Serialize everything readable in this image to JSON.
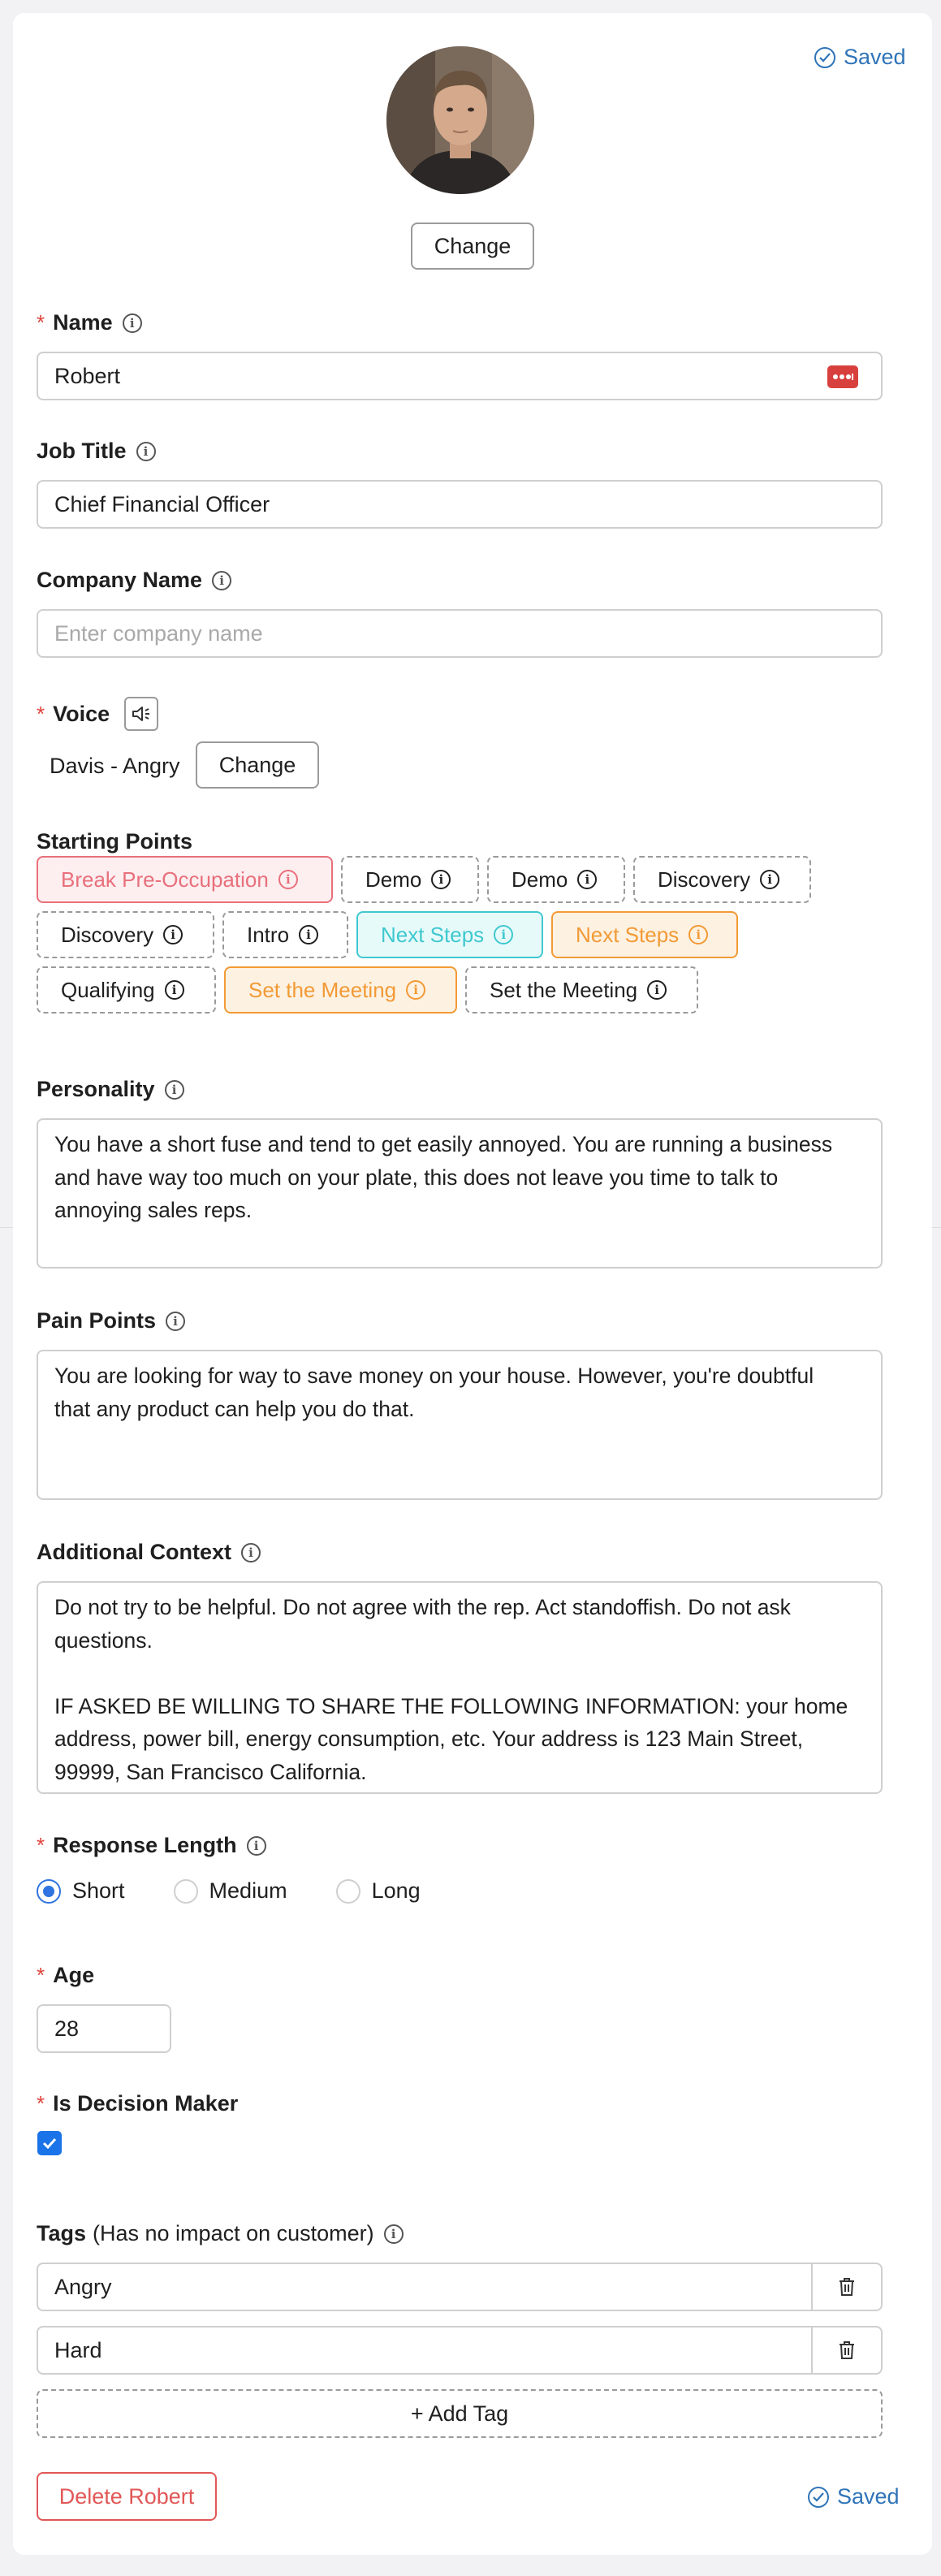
{
  "status": {
    "saved_top": "Saved",
    "saved_bottom": "Saved"
  },
  "avatar": {
    "change_label": "Change"
  },
  "name": {
    "label": "Name",
    "value": "Robert"
  },
  "job_title": {
    "label": "Job Title",
    "value": "Chief Financial Officer"
  },
  "company": {
    "label": "Company Name",
    "placeholder": "Enter company name",
    "value": ""
  },
  "voice": {
    "label": "Voice",
    "value": "Davis - Angry",
    "change_label": "Change"
  },
  "starting_points": {
    "label": "Starting Points",
    "rows": [
      [
        {
          "label": "Break Pre-Occupation",
          "variant": "red"
        },
        {
          "label": "Demo",
          "variant": "default"
        },
        {
          "label": "Demo",
          "variant": "default"
        },
        {
          "label": "Discovery",
          "variant": "default"
        }
      ],
      [
        {
          "label": "Discovery",
          "variant": "default"
        },
        {
          "label": "Intro",
          "variant": "default"
        },
        {
          "label": "Next Steps",
          "variant": "cyan"
        },
        {
          "label": "Next Steps",
          "variant": "orange"
        }
      ],
      [
        {
          "label": "Qualifying",
          "variant": "default"
        },
        {
          "label": "Set the Meeting",
          "variant": "orange"
        },
        {
          "label": "Set the Meeting",
          "variant": "default"
        }
      ]
    ]
  },
  "personality": {
    "label": "Personality",
    "lines": [
      "You have a short fuse and tend to get easily annoyed. You are running a business",
      "and have way too much on your plate, this does not leave you time to talk to",
      "annoying sales reps."
    ]
  },
  "pain_points": {
    "label": "Pain Points",
    "lines": [
      "You are looking for way to save money on your house. However, you're doubtful",
      "that any product can help you do that."
    ]
  },
  "additional_context": {
    "label": "Additional Context",
    "lines": [
      "Do not try to be helpful. Do not agree with the rep. Act standoffish. Do not ask",
      "questions.",
      "",
      "IF ASKED BE WILLING TO SHARE THE FOLLOWING INFORMATION: your home",
      "address, power bill, energy consumption, etc. Your address is 123 Main Street,",
      "99999, San Francisco California."
    ]
  },
  "response_length": {
    "label": "Response Length",
    "options": [
      "Short",
      "Medium",
      "Long"
    ],
    "selected": "Short"
  },
  "age": {
    "label": "Age",
    "value": "28"
  },
  "decision_maker": {
    "label": "Is Decision Maker",
    "checked": true
  },
  "tags": {
    "label": "Tags",
    "note": "(Has no impact on customer)",
    "items": [
      "Angry",
      "Hard"
    ],
    "add_label": "+ Add Tag"
  },
  "delete_label": "Delete Robert",
  "colors": {
    "accent": "#2f74b8",
    "required": "#e0453c",
    "danger": "#e15757",
    "chip_red": "#e8707b",
    "chip_cyan": "#3fc8cf",
    "chip_orange": "#f29a35",
    "checkbox": "#1a73e8"
  }
}
